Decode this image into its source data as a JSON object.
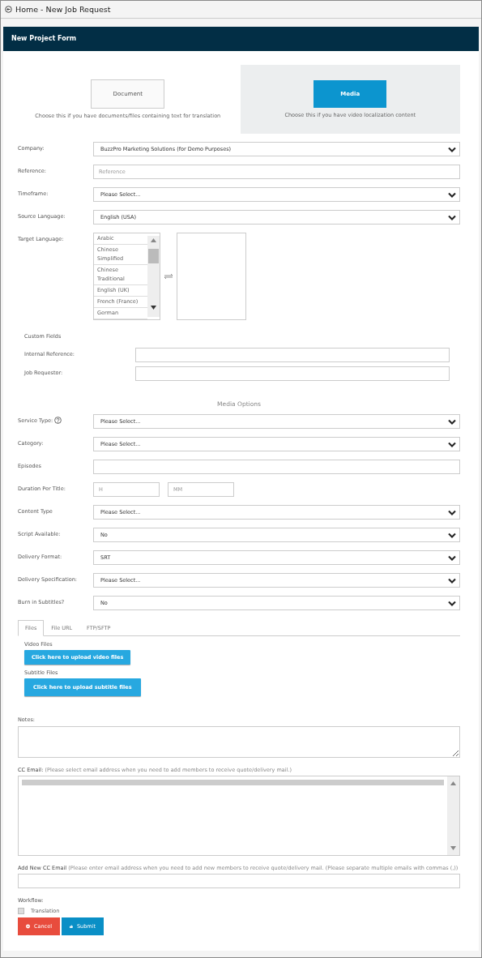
{
  "header": {
    "title": "Home - New Job Request"
  },
  "form_title": "New Project Form",
  "project_types": [
    {
      "label": "Document",
      "description": "Choose this if you have documents/files containing text for translation",
      "selected": false
    },
    {
      "label": "Media",
      "description": "Choose this if you have video localization content",
      "selected": true
    }
  ],
  "fields": [
    {
      "label": "Company:",
      "kind": "select",
      "value": "BuzzPro Marketing Solutions (for Demo Purposes)"
    },
    {
      "label": "Reference:",
      "kind": "text",
      "placeholder": "Reference"
    },
    {
      "label": "Timeframe:",
      "kind": "select",
      "value": "Please Select..."
    },
    {
      "label": "Source Language:",
      "kind": "select",
      "value": "English (USA)"
    },
    {
      "label": "Target Language:",
      "kind": "languages",
      "options": [
        "Arabic",
        "Chinese Simplified",
        "Chinese Traditional",
        "English (UK)",
        "French (France)",
        "German"
      ]
    }
  ],
  "custom_fields": {
    "title": "Custom Fields",
    "fields": [
      {
        "label": "Internal Reference:",
        "kind": "text"
      },
      {
        "label": "Job Requestor:",
        "kind": "text"
      }
    ]
  },
  "media_options": {
    "title": "Media Options",
    "fields": [
      {
        "label": "Service Type:",
        "kind": "select",
        "value": "Please Select...",
        "help": true
      },
      {
        "label": "Category:",
        "kind": "select",
        "value": "Please Select..."
      },
      {
        "label": "Episodes",
        "kind": "text"
      },
      {
        "label": "Duration Per Title:",
        "kind": "duration",
        "inputs": [
          {
            "placeholder": "H"
          },
          {
            "placeholder": "MM"
          }
        ]
      },
      {
        "label": "Content Type",
        "kind": "select",
        "value": "Please Select..."
      },
      {
        "label": "Script Available:",
        "kind": "select",
        "value": "No"
      },
      {
        "label": "Delivery Format:",
        "kind": "select",
        "value": "SRT"
      },
      {
        "label": "Delivery Specification:",
        "kind": "select",
        "value": "Please Select..."
      },
      {
        "label": "Burn in Subtitles?",
        "kind": "select",
        "value": "No"
      }
    ]
  },
  "upload_tabs": [
    {
      "label": "Files",
      "selected": true
    },
    {
      "label": "File URL",
      "selected": false
    },
    {
      "label": "FTP/SFTP",
      "selected": false
    }
  ],
  "uploads": [
    {
      "label": "Video Files",
      "button": "Click here to upload video files"
    },
    {
      "label": "Subtitle Files",
      "button": "Click here to upload subtitle files"
    }
  ],
  "notes": {
    "label": "Notes:"
  },
  "cc_email": {
    "label": "CC Email:",
    "hint": "(Please select email address when you need to add members to receive quote/delivery mail.)"
  },
  "add_cc_email": {
    "label": "Add New CC Email",
    "hint": "(Please enter email address when you need to add new members to receive quote/delivery mail. (Please separate multiple emails with commas (,))"
  },
  "workflow": {
    "label": "Workflow:",
    "options": [
      {
        "label": "Translation",
        "checked": false,
        "disabled": true
      }
    ]
  },
  "buttons": [
    {
      "label": "Cancel",
      "kind": "cancel"
    },
    {
      "label": "Submit",
      "kind": "submit"
    }
  ]
}
